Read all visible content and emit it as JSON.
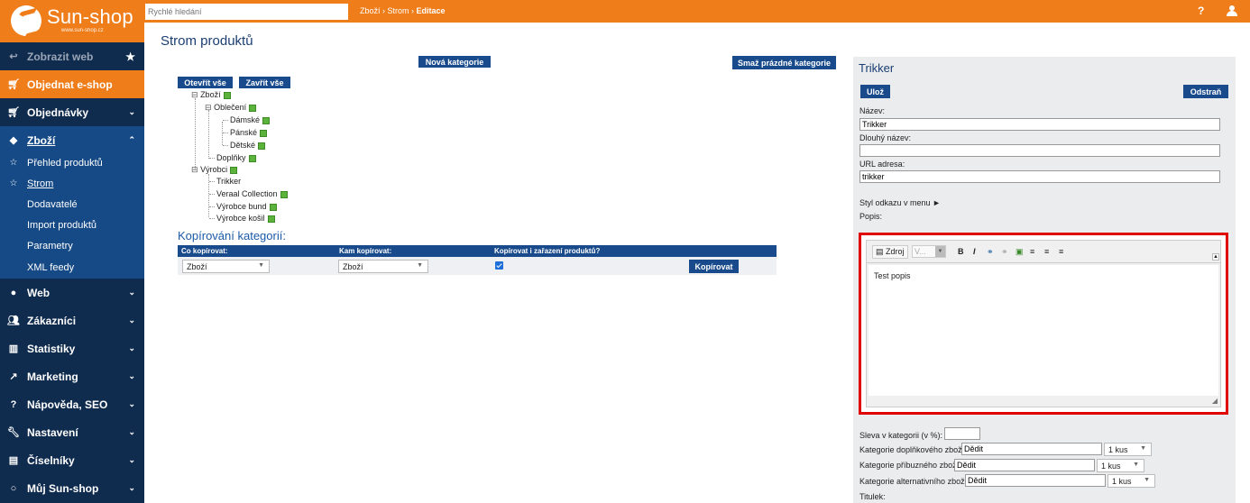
{
  "app": {
    "logo_text": "Sun-shop",
    "logo_url": "www.sun-shop.cz",
    "search_placeholder": "Rychlé hledání",
    "breadcrumb": [
      "Zboží",
      "Strom",
      "Editace"
    ],
    "help_label": "?"
  },
  "sidebar": {
    "items": [
      {
        "label": "Zobrazit web",
        "icon": "reply-icon"
      },
      {
        "label": "Objednat e-shop",
        "icon": "cart-icon"
      },
      {
        "label": "Objednávky",
        "icon": "cart-icon"
      },
      {
        "label": "Zboží",
        "icon": "tag-icon"
      },
      {
        "label": "Web",
        "icon": "globe-icon"
      },
      {
        "label": "Zákazníci",
        "icon": "users-icon"
      },
      {
        "label": "Statistiky",
        "icon": "bar-chart-icon"
      },
      {
        "label": "Marketing",
        "icon": "line-chart-icon"
      },
      {
        "label": "Nápověda, SEO",
        "icon": "question-icon"
      },
      {
        "label": "Nastavení",
        "icon": "wrench-icon"
      },
      {
        "label": "Číselníky",
        "icon": "list-icon"
      },
      {
        "label": "Můj Sun-shop",
        "icon": "circle-icon"
      }
    ],
    "submenu": [
      {
        "label": "Přehled produktů"
      },
      {
        "label": "Strom"
      },
      {
        "label": "Dodavatelé"
      },
      {
        "label": "Import produktů"
      },
      {
        "label": "Parametry"
      },
      {
        "label": "XML feedy"
      }
    ]
  },
  "main": {
    "title": "Strom produktů",
    "new_category": "Nová kategorie",
    "delete_empty": "Smaž prázdné kategorie",
    "open_all": "Otevřít vše",
    "close_all": "Zavřít vše",
    "tree": {
      "zbozi": "Zboží",
      "obleceni": "Oblečení",
      "damske": "Dámské",
      "panske": "Pánské",
      "detske": "Dětské",
      "doplnky": "Doplňky",
      "vyrobci": "Výrobci",
      "trikker": "Trikker",
      "veraal": "Veraal Collection",
      "vyrobce_bund": "Výrobce bund",
      "vyrobce_kosil": "Výrobce košil"
    },
    "copy": {
      "title": "Kopírování kategorií:",
      "col_from": "Co kopírovat:",
      "col_to": "Kam kopírovat:",
      "col_include": "Kopírovat i zařazení produktů?",
      "from_value": "Zboží",
      "to_value": "Zboží",
      "include_checked": true,
      "button": "Kopírovat"
    }
  },
  "panel": {
    "title": "Trikker",
    "save": "Ulož",
    "delete": "Odstraň",
    "name_label": "Název:",
    "name_value": "Trikker",
    "long_name_label": "Dlouhý název:",
    "long_name_value": "",
    "url_label": "URL adresa:",
    "url_value": "trikker",
    "link_style": "Styl odkazu v menu ►",
    "desc_label": "Popis:",
    "editor": {
      "source": "Zdroj",
      "style_select": "V...",
      "bold": "B",
      "italic": "I",
      "content": "Test popis"
    },
    "discount_label": "Sleva v kategorii (v %):",
    "discount_value": "",
    "accessory_label": "Kategorie doplňkového zboží:",
    "accessory_value": "Dědit",
    "accessory_qty": "1 kus",
    "related_label": "Kategorie příbuzného zboží:",
    "related_value": "Dědit",
    "related_qty": "1 kus",
    "alternative_label": "Kategorie alternativního zboží:",
    "alternative_value": "Dědit",
    "alternative_qty": "1 kus",
    "titulek_label": "Titulek:"
  }
}
